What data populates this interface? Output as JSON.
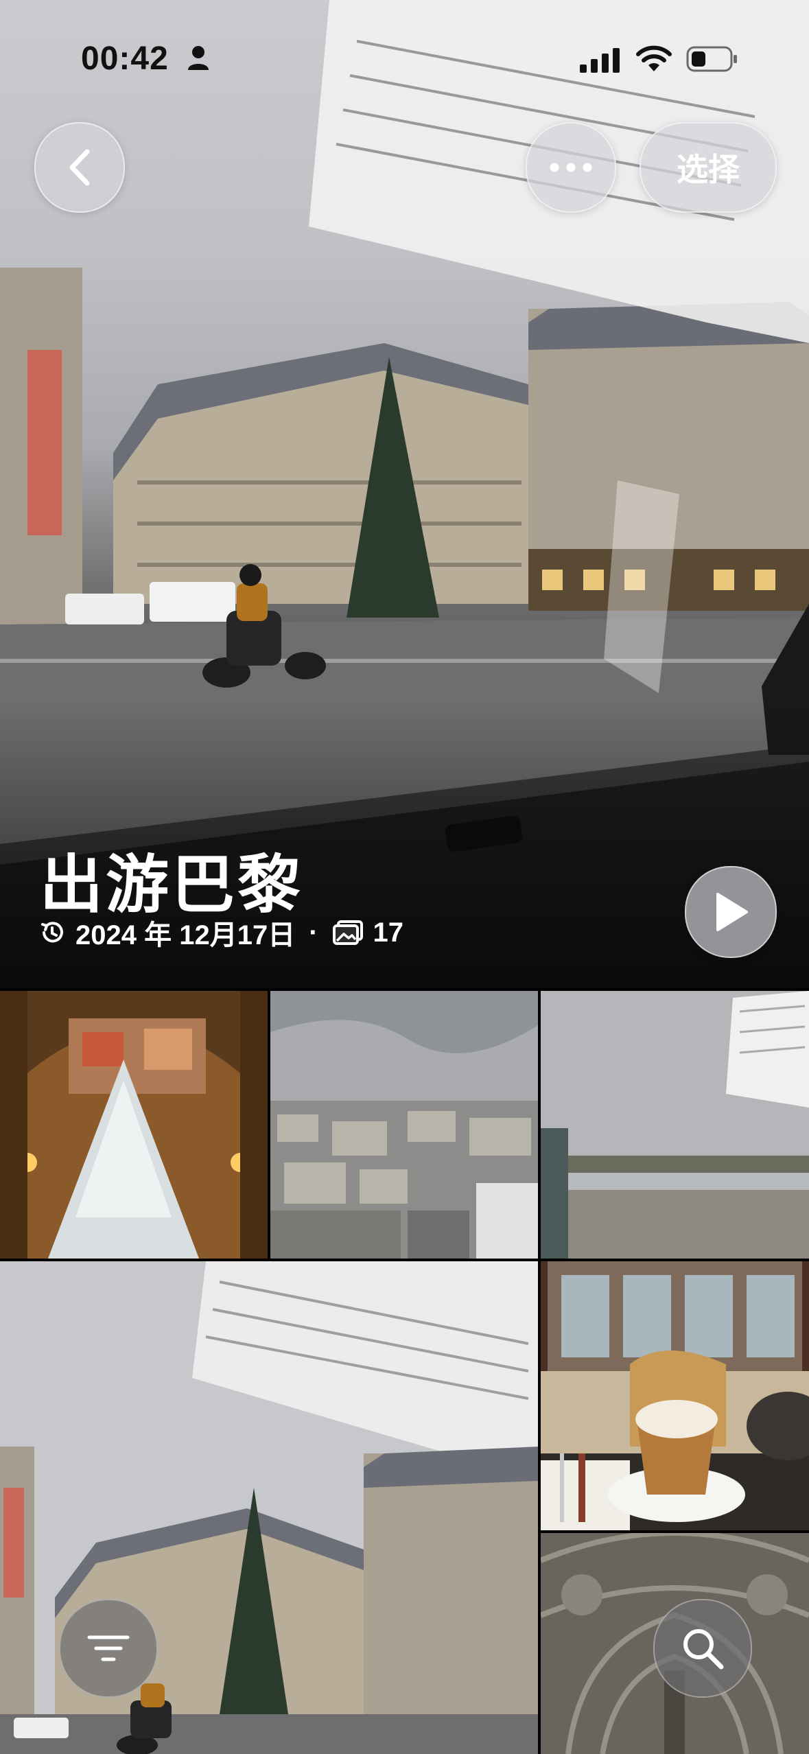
{
  "status_bar": {
    "time": "00:42"
  },
  "header": {
    "select_label": "选择"
  },
  "album": {
    "title": "出游巴黎",
    "date": "2024 年 12月17日",
    "separator": "·",
    "photo_count": "17"
  },
  "icons": {
    "back": "chevron-left-icon",
    "more": "ellipsis-icon",
    "play": "play-icon",
    "filter": "filter-lines-icon",
    "search": "search-icon"
  },
  "colors": {
    "glass": "#d2d4d8",
    "text_light": "#ffffff"
  }
}
